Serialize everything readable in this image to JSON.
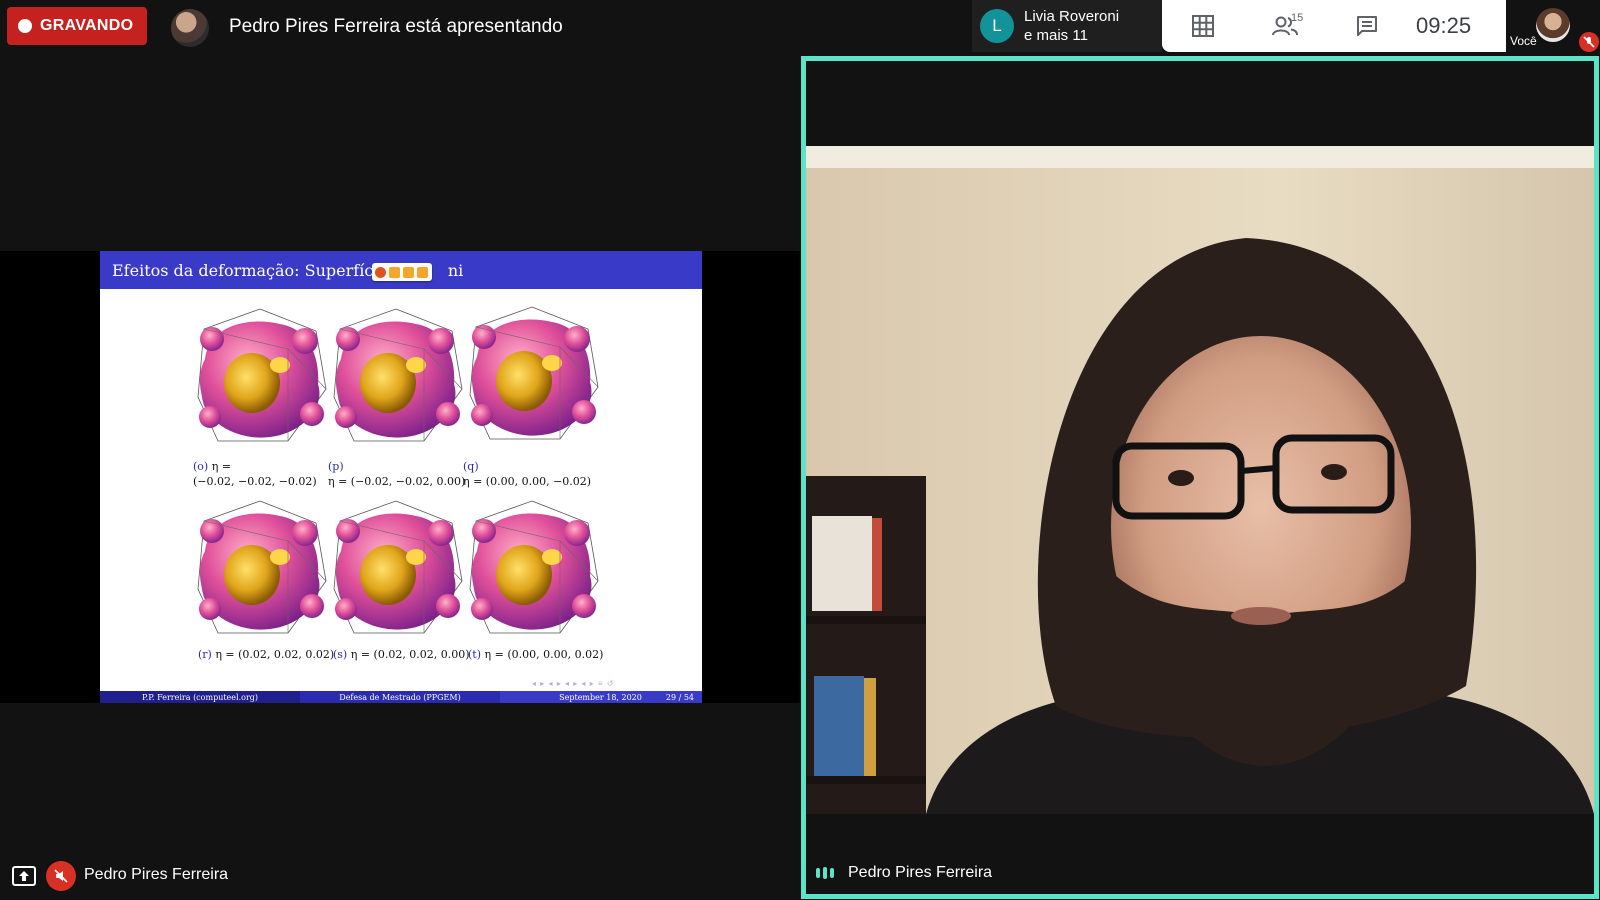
{
  "recording": {
    "label": "GRAVANDO"
  },
  "presenting": {
    "text": "Pedro Pires Ferreira está apresentando"
  },
  "people_chip": {
    "initial": "L",
    "line1": "Livia Roveroni",
    "line2": "e mais 11"
  },
  "controls": {
    "people_count": "15",
    "clock": "09:25",
    "icons": [
      "grid-icon",
      "people-icon",
      "chat-icon"
    ]
  },
  "self": {
    "label": "Você"
  },
  "slide": {
    "title": "Efeitos da deformação: Superfície",
    "title_tail": "ni",
    "captions": [
      {
        "tag": "(o)",
        "text": "η =",
        "line2": "(−0.02, −0.02, −0.02)"
      },
      {
        "tag": "(p)",
        "text": "",
        "line2": "η = (−0.02, −0.02, 0.00)"
      },
      {
        "tag": "(q)",
        "text": "",
        "line2": "η = (0.00, 0.00, −0.02)"
      },
      {
        "tag": "(r)",
        "text": "η = (0.02, 0.02, 0.02)"
      },
      {
        "tag": "(s)",
        "text": "η = (0.02, 0.02, 0.00)"
      },
      {
        "tag": "(t)",
        "text": "η = (0.00, 0.00, 0.02)"
      }
    ],
    "footer": {
      "author": "P.P. Ferreira  (computeel.org)",
      "event": "Defesa de Mestrado (PPGEM)",
      "date": "September 18, 2020",
      "page": "29 / 54"
    },
    "colors": {
      "title_bar": "#3a3ac8",
      "footer_dark": "#1f1f8e",
      "footer_mid": "#2b2bb0",
      "footer_light": "#3a3ac8"
    }
  },
  "speaker": {
    "name": "Pedro Pires Ferreira",
    "highlight_color": "#5de4c7"
  },
  "bottom": {
    "name": "Pedro Pires Ferreira"
  }
}
